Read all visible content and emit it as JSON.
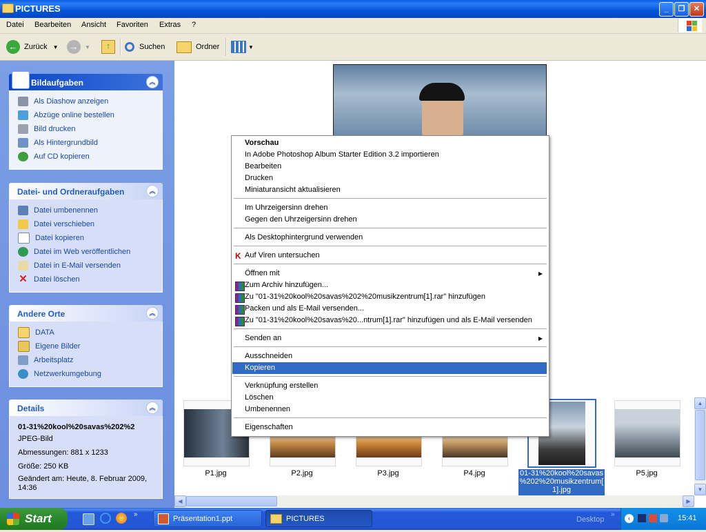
{
  "window": {
    "title": "PICTURES"
  },
  "menubar": [
    "Datei",
    "Bearbeiten",
    "Ansicht",
    "Favoriten",
    "Extras",
    "?"
  ],
  "toolbar": {
    "back": "Zurück",
    "search": "Suchen",
    "folders": "Ordner"
  },
  "left_pane": {
    "picture_tasks": {
      "title": "Bildaufgaben",
      "items": [
        "Als Diashow anzeigen",
        "Abzüge online bestellen",
        "Bild drucken",
        "Als Hintergrundbild",
        "Auf CD kopieren"
      ]
    },
    "file_tasks": {
      "title": "Datei- und Ordneraufgaben",
      "items": [
        "Datei umbenennen",
        "Datei verschieben",
        "Datei kopieren",
        "Datei im Web veröffentlichen",
        "Datei in E-Mail versenden",
        "Datei löschen"
      ]
    },
    "other_places": {
      "title": "Andere Orte",
      "items": [
        "DATA",
        "Eigene Bilder",
        "Arbeitsplatz",
        "Netzwerkumgebung"
      ]
    },
    "details": {
      "title": "Details",
      "filename": "01-31%20kool%20savas%202%2",
      "type": "JPEG-Bild",
      "dimensions": "Abmessungen: 881 x 1233",
      "size": "Größe: 250 KB",
      "modified_1": "Geändert am: Heute, 8. Februar 2009,",
      "modified_2": "14:36"
    }
  },
  "context_menu": {
    "items": [
      "Vorschau",
      "In Adobe Photoshop Album Starter Edition 3.2 importieren",
      "Bearbeiten",
      "Drucken",
      "Miniaturansicht aktualisieren",
      "Im Uhrzeigersinn drehen",
      "Gegen den Uhrzeigersinn drehen",
      "Als Desktophintergrund verwenden",
      "Auf Viren untersuchen",
      "Öffnen mit",
      "Zum Archiv hinzufügen...",
      "Zu \"01-31%20kool%20savas%202%20musikzentrum[1].rar\" hinzufügen",
      "Packen und als E-Mail versenden...",
      "Zu \"01-31%20kool%20savas%20...ntrum[1].rar\" hinzufügen und als E-Mail versenden",
      "Senden an",
      "Ausschneiden",
      "Kopieren",
      "Verknüpfung erstellen",
      "Löschen",
      "Umbenennen",
      "Eigenschaften"
    ],
    "selected": "Kopieren"
  },
  "filmstrip": {
    "thumbs": [
      "P1.jpg",
      "P2.jpg",
      "P3.jpg",
      "P4.jpg",
      "01-31%20kool%20savas%202%20musikzentrum[1].jpg",
      "P5.jpg"
    ],
    "selected_label_lines": [
      "01-31%20kool%20savas",
      "%202%20musikzentrum[",
      "1].jpg"
    ]
  },
  "taskbar": {
    "start": "Start",
    "tasks": [
      "Präsentation1.ppt",
      "PICTURES"
    ],
    "desktop": "Desktop",
    "clock": "15:41"
  },
  "colors": {
    "selection": "#316ac5",
    "titlebar": "#0454d8",
    "taskbar": "#2457d6",
    "start": "#2e8a2e"
  }
}
